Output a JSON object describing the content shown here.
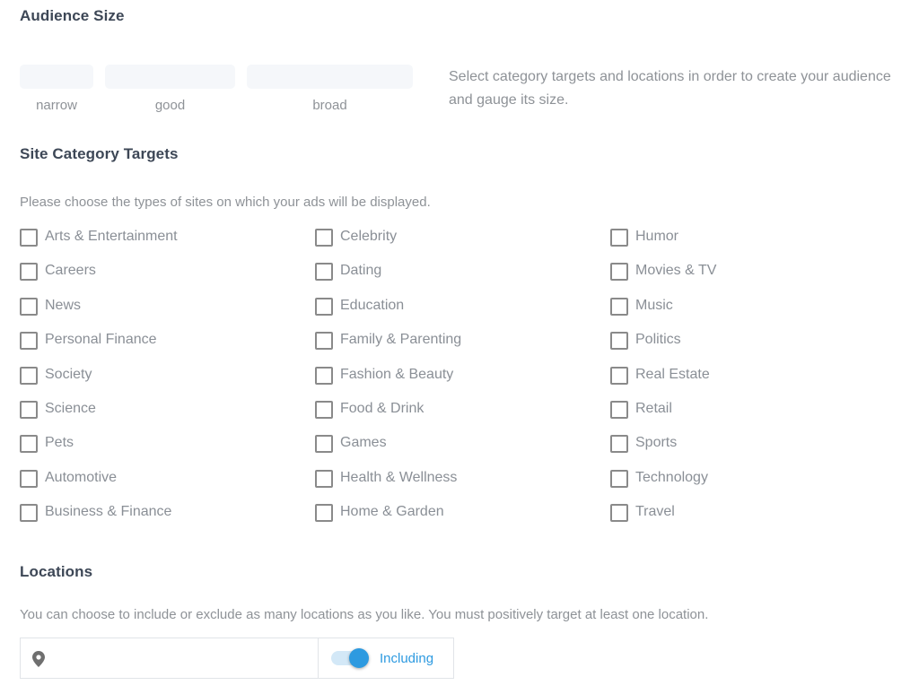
{
  "audience": {
    "title": "Audience Size",
    "levels": [
      {
        "label": "narrow"
      },
      {
        "label": "good"
      },
      {
        "label": "broad"
      }
    ],
    "help": "Select category targets and locations in order to create your audience and gauge its size."
  },
  "categories": {
    "title": "Site Category Targets",
    "description": "Please choose the types of sites on which your ads will be displayed.",
    "columns": [
      [
        {
          "label": "Arts & Entertainment",
          "checked": false
        },
        {
          "label": "Careers",
          "checked": false
        },
        {
          "label": "News",
          "checked": false
        },
        {
          "label": "Personal Finance",
          "checked": false
        },
        {
          "label": "Society",
          "checked": false
        },
        {
          "label": "Science",
          "checked": false
        },
        {
          "label": "Pets",
          "checked": false
        },
        {
          "label": "Automotive",
          "checked": false
        },
        {
          "label": "Business & Finance",
          "checked": false
        }
      ],
      [
        {
          "label": "Celebrity",
          "checked": false
        },
        {
          "label": "Dating",
          "checked": false
        },
        {
          "label": "Education",
          "checked": false
        },
        {
          "label": "Family & Parenting",
          "checked": false
        },
        {
          "label": "Fashion & Beauty",
          "checked": false
        },
        {
          "label": "Food & Drink",
          "checked": false
        },
        {
          "label": "Games",
          "checked": false
        },
        {
          "label": "Health & Wellness",
          "checked": false
        },
        {
          "label": "Home & Garden",
          "checked": false
        }
      ],
      [
        {
          "label": "Humor",
          "checked": false
        },
        {
          "label": "Movies & TV",
          "checked": false
        },
        {
          "label": "Music",
          "checked": false
        },
        {
          "label": "Politics",
          "checked": false
        },
        {
          "label": "Real Estate",
          "checked": false
        },
        {
          "label": "Retail",
          "checked": false
        },
        {
          "label": "Sports",
          "checked": false
        },
        {
          "label": "Technology",
          "checked": false
        },
        {
          "label": "Travel",
          "checked": false
        }
      ]
    ]
  },
  "locations": {
    "title": "Locations",
    "description": "You can choose to include or exclude as many locations as you like. You must positively target at least one location.",
    "input_value": "",
    "input_placeholder": "",
    "toggle_on": true,
    "toggle_label": "Including",
    "accent": "#2d9ae0"
  }
}
